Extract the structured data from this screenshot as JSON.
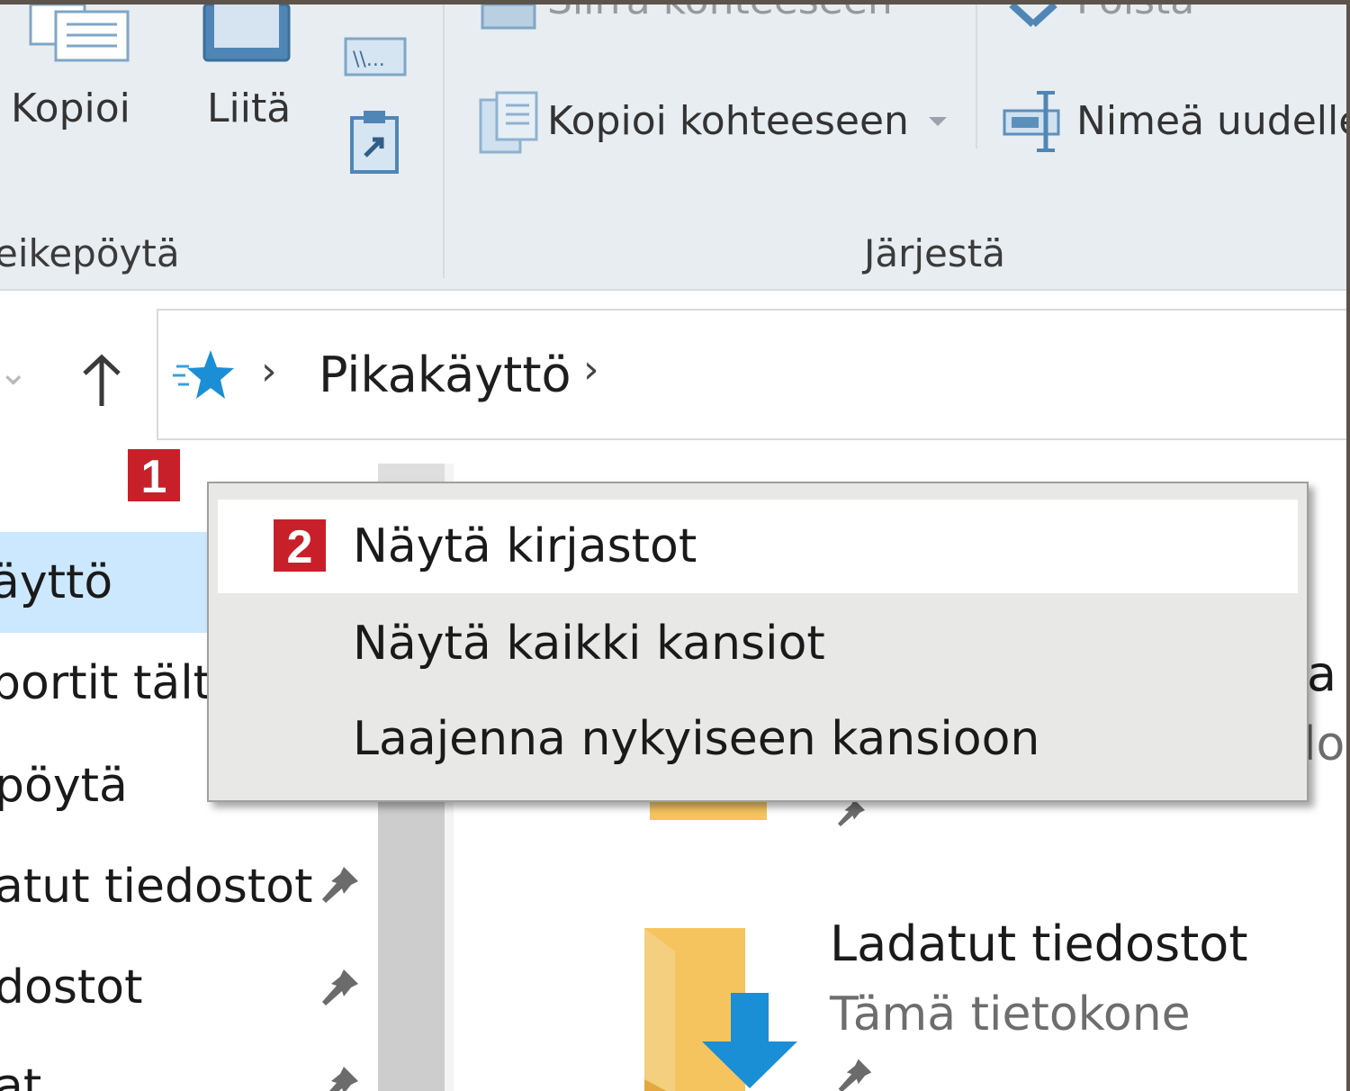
{
  "ribbon": {
    "clipboard_group": {
      "copy_label": "Kopioi",
      "paste_label": "Liitä",
      "group_label": "eikepöytä"
    },
    "organize_group": {
      "move_to_label": "Siirrä kohteeseen",
      "copy_to_label": "Kopioi kohteeseen",
      "delete_label": "Poista",
      "rename_label": "Nimeä uudelle",
      "group_label": "Järjestä"
    }
  },
  "address_bar": {
    "breadcrumb": [
      "Pikakäyttö"
    ]
  },
  "nav_pane": {
    "items": [
      {
        "label": "äyttö",
        "selected": true,
        "pinned": false
      },
      {
        "label": "portit tältä",
        "selected": false,
        "pinned": false
      },
      {
        "label": "pöytä",
        "selected": false,
        "pinned": false
      },
      {
        "label": "atut tiedostot",
        "selected": false,
        "pinned": true
      },
      {
        "label": "dostot",
        "selected": false,
        "pinned": true
      },
      {
        "label": "at",
        "selected": false,
        "pinned": true
      }
    ]
  },
  "content": {
    "partial_right": [
      "a",
      "lo"
    ],
    "folder": {
      "name": "Ladatut tiedostot",
      "location": "Tämä tietokone"
    }
  },
  "badges": {
    "step1": "1",
    "step2": "2"
  },
  "context_menu": {
    "items": [
      {
        "label": "Näytä kirjastot",
        "highlighted": true
      },
      {
        "label": "Näytä kaikki kansiot",
        "highlighted": false
      },
      {
        "label": "Laajenna nykyiseen kansioon",
        "highlighted": false
      }
    ]
  },
  "colors": {
    "ribbon_bg": "#e8edf1",
    "selection": "#cce8ff",
    "badge": "#c8202a",
    "folder": "#f5c45e",
    "accent_blue": "#1a8fd6"
  }
}
